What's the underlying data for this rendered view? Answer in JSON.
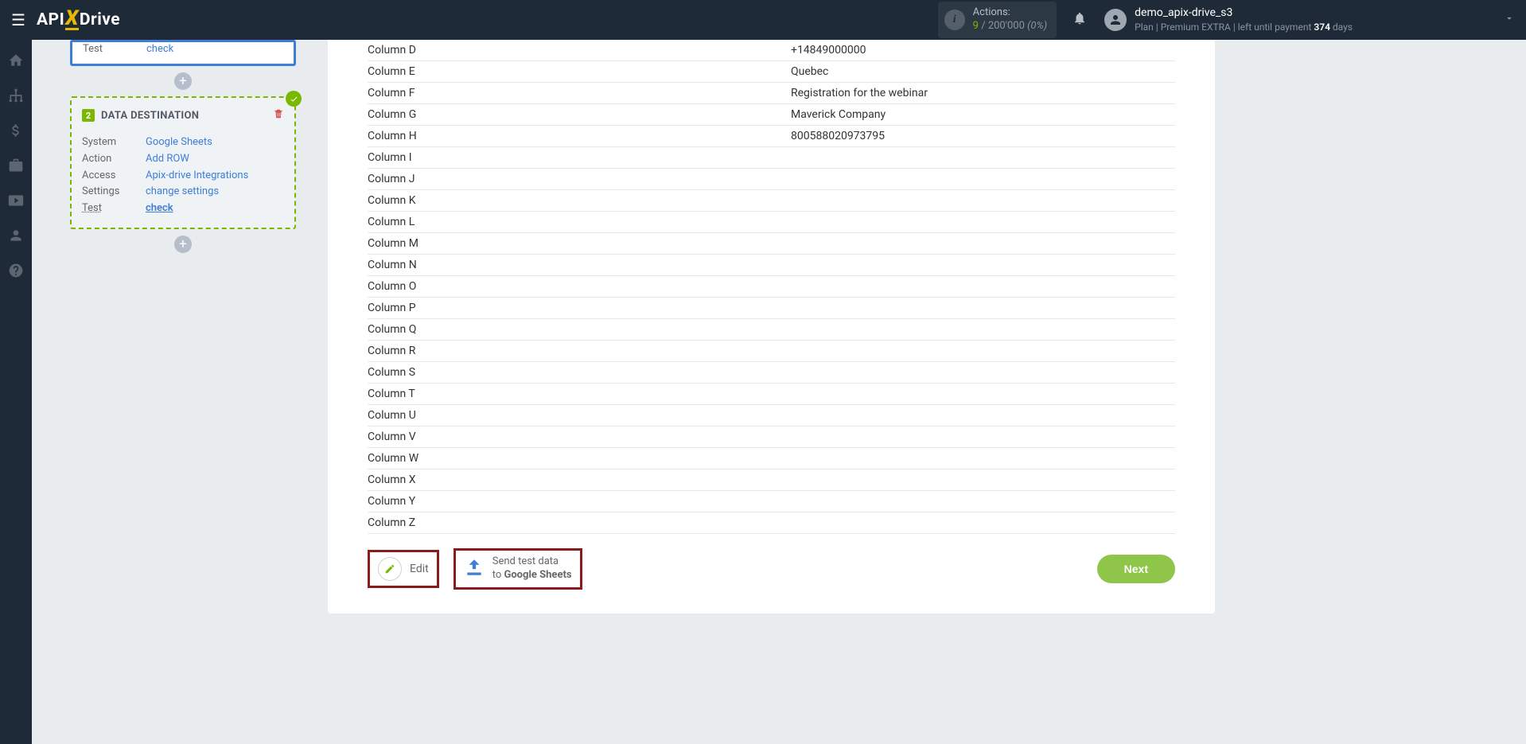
{
  "header": {
    "actions_label": "Actions:",
    "actions_used": "9",
    "actions_slash": " / ",
    "actions_total": "200'000",
    "actions_pct": " (0%)",
    "user_name": "demo_apix-drive_s3",
    "plan_prefix": "Plan | ",
    "plan_name": "Premium EXTRA",
    "plan_mid": " | left until payment ",
    "plan_days": "374",
    "plan_suffix": " days"
  },
  "source_card": {
    "test_label": "Test",
    "test_value": "check"
  },
  "dest_card": {
    "step_num": "2",
    "title": "DATA DESTINATION",
    "rows": [
      {
        "label": "System",
        "value": "Google Sheets"
      },
      {
        "label": "Action",
        "value": "Add ROW"
      },
      {
        "label": "Access",
        "value": "Apix-drive Integrations"
      },
      {
        "label": "Settings",
        "value": "change settings"
      },
      {
        "label": "Test",
        "value": "check"
      }
    ]
  },
  "data_rows": [
    {
      "c1": "Column D",
      "c2": "+14849000000"
    },
    {
      "c1": "Column E",
      "c2": "Quebec"
    },
    {
      "c1": "Column F",
      "c2": "Registration for the webinar"
    },
    {
      "c1": "Column G",
      "c2": "Maverick Company"
    },
    {
      "c1": "Column H",
      "c2": "800588020973795"
    },
    {
      "c1": "Column I",
      "c2": ""
    },
    {
      "c1": "Column J",
      "c2": ""
    },
    {
      "c1": "Column K",
      "c2": ""
    },
    {
      "c1": "Column L",
      "c2": ""
    },
    {
      "c1": "Column M",
      "c2": ""
    },
    {
      "c1": "Column N",
      "c2": ""
    },
    {
      "c1": "Column O",
      "c2": ""
    },
    {
      "c1": "Column P",
      "c2": ""
    },
    {
      "c1": "Column Q",
      "c2": ""
    },
    {
      "c1": "Column R",
      "c2": ""
    },
    {
      "c1": "Column S",
      "c2": ""
    },
    {
      "c1": "Column T",
      "c2": ""
    },
    {
      "c1": "Column U",
      "c2": ""
    },
    {
      "c1": "Column V",
      "c2": ""
    },
    {
      "c1": "Column W",
      "c2": ""
    },
    {
      "c1": "Column X",
      "c2": ""
    },
    {
      "c1": "Column Y",
      "c2": ""
    },
    {
      "c1": "Column Z",
      "c2": ""
    }
  ],
  "footer": {
    "edit_label": "Edit",
    "send_line1": "Send test data",
    "send_line2_prefix": "to ",
    "send_line2_bold": "Google Sheets",
    "next_label": "Next"
  }
}
